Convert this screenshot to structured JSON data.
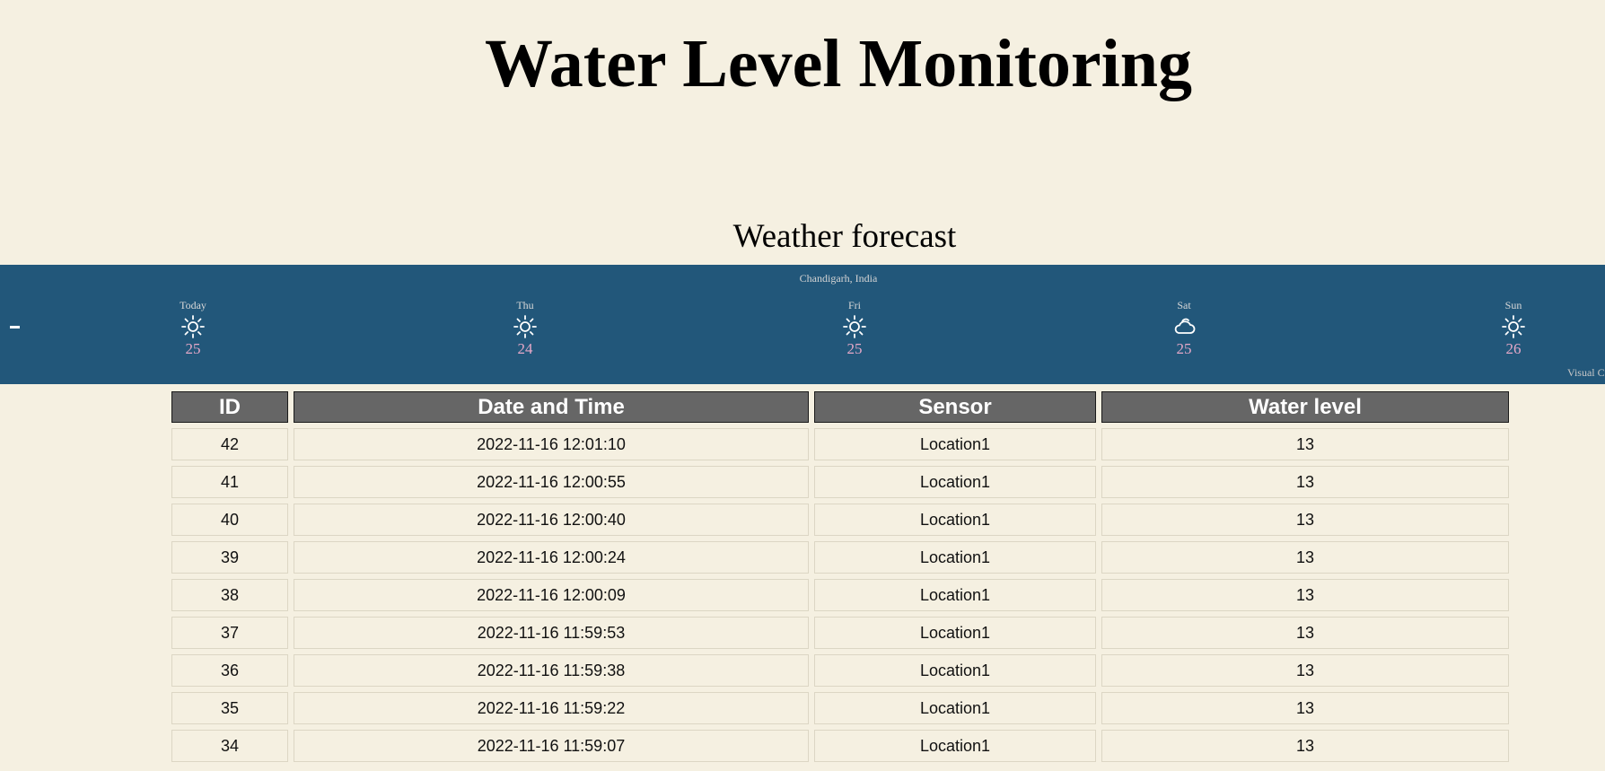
{
  "page": {
    "title": "Water Level Monitoring"
  },
  "weather": {
    "heading": "Weather forecast",
    "location": "Chandigarh, India",
    "toggle_label": "-",
    "credit": "Visual Cr",
    "days": [
      {
        "name": "Today",
        "icon": "sun-icon",
        "temp": "25"
      },
      {
        "name": "Thu",
        "icon": "sun-icon",
        "temp": "24"
      },
      {
        "name": "Fri",
        "icon": "sun-icon",
        "temp": "25"
      },
      {
        "name": "Sat",
        "icon": "cloud-icon",
        "temp": "25"
      },
      {
        "name": "Sun",
        "icon": "sun-icon",
        "temp": "26"
      }
    ],
    "colors": {
      "background": "#22577a",
      "temp": "#e6a8c8"
    }
  },
  "table": {
    "headers": {
      "id": "ID",
      "datetime": "Date and Time",
      "sensor": "Sensor",
      "level": "Water level"
    },
    "rows": [
      {
        "id": "42",
        "datetime": "2022-11-16 12:01:10",
        "sensor": "Location1",
        "level": "13"
      },
      {
        "id": "41",
        "datetime": "2022-11-16 12:00:55",
        "sensor": "Location1",
        "level": "13"
      },
      {
        "id": "40",
        "datetime": "2022-11-16 12:00:40",
        "sensor": "Location1",
        "level": "13"
      },
      {
        "id": "39",
        "datetime": "2022-11-16 12:00:24",
        "sensor": "Location1",
        "level": "13"
      },
      {
        "id": "38",
        "datetime": "2022-11-16 12:00:09",
        "sensor": "Location1",
        "level": "13"
      },
      {
        "id": "37",
        "datetime": "2022-11-16 11:59:53",
        "sensor": "Location1",
        "level": "13"
      },
      {
        "id": "36",
        "datetime": "2022-11-16 11:59:38",
        "sensor": "Location1",
        "level": "13"
      },
      {
        "id": "35",
        "datetime": "2022-11-16 11:59:22",
        "sensor": "Location1",
        "level": "13"
      },
      {
        "id": "34",
        "datetime": "2022-11-16 11:59:07",
        "sensor": "Location1",
        "level": "13"
      }
    ]
  }
}
